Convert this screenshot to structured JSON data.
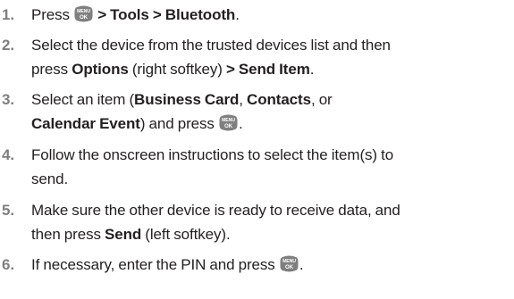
{
  "steps": [
    {
      "number": "1.",
      "lines": [
        [
          {
            "t": "Press "
          },
          {
            "icon": "menu-ok-key-icon"
          },
          {
            "t": " > Tools > Bluetooth",
            "b": true
          },
          {
            "t": "."
          }
        ]
      ]
    },
    {
      "number": "2.",
      "lines": [
        [
          {
            "t": "Select the device from the trusted devices list and then"
          }
        ],
        [
          {
            "t": "press "
          },
          {
            "t": "Options",
            "b": true
          },
          {
            "t": " (right softkey) "
          },
          {
            "t": "> Send Item",
            "b": true
          },
          {
            "t": "."
          }
        ]
      ]
    },
    {
      "number": "3.",
      "lines": [
        [
          {
            "t": "Select an item ("
          },
          {
            "t": "Business Card",
            "b": true
          },
          {
            "t": ", "
          },
          {
            "t": "Contacts",
            "b": true
          },
          {
            "t": ", or"
          }
        ],
        [
          {
            "t": "Calendar Event",
            "b": true
          },
          {
            "t": ") and press "
          },
          {
            "icon": "menu-ok-key-icon"
          },
          {
            "t": "."
          }
        ]
      ]
    },
    {
      "number": "4.",
      "lines": [
        [
          {
            "t": "Follow the onscreen instructions to select the item(s) to"
          }
        ],
        [
          {
            "t": "send."
          }
        ]
      ]
    },
    {
      "number": "5.",
      "lines": [
        [
          {
            "t": "Make sure the other device is ready to receive data, and"
          }
        ],
        [
          {
            "t": "then press "
          },
          {
            "t": "Send",
            "b": true
          },
          {
            "t": " (left softkey)."
          }
        ]
      ]
    },
    {
      "number": "6.",
      "lines": [
        [
          {
            "t": "If necessary, enter the PIN and press "
          },
          {
            "icon": "menu-ok-key-icon"
          },
          {
            "t": "."
          }
        ]
      ]
    }
  ],
  "key_icon": {
    "line1": "MENU",
    "line2": "OK",
    "fill": "#7f7f7f",
    "text_color": "#ffffff"
  },
  "colors": {
    "text": "#231f20",
    "step_number": "#7f7f7f"
  }
}
